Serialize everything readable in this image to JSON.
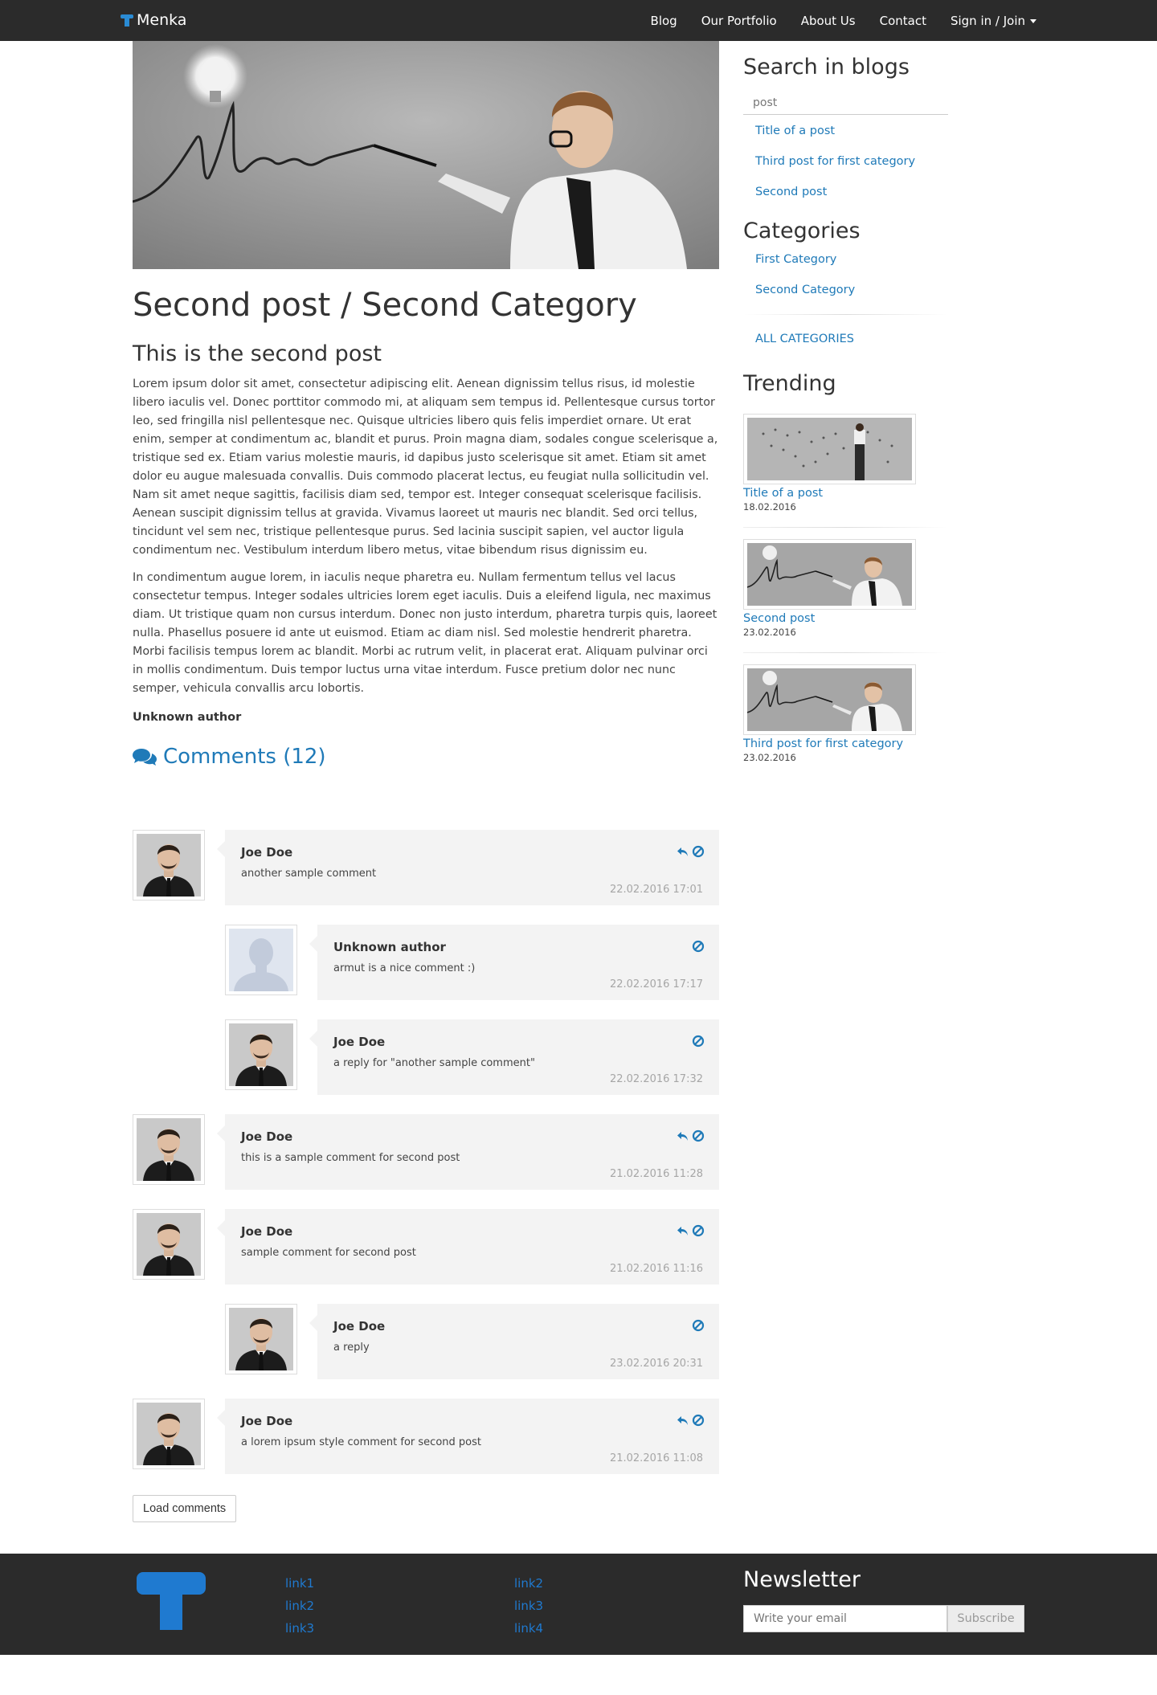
{
  "navbar": {
    "brand": "Menka",
    "items": [
      {
        "label": "Blog"
      },
      {
        "label": "Our Portfolio"
      },
      {
        "label": "About Us"
      },
      {
        "label": "Contact"
      },
      {
        "label": "Sign in / Join"
      }
    ]
  },
  "post": {
    "title": "Second post / Second Category",
    "subtitle": "This is the second post",
    "paragraphs": [
      "Lorem ipsum dolor sit amet, consectetur adipiscing elit. Aenean dignissim tellus risus, id molestie libero iaculis vel. Donec porttitor commodo mi, at aliquam sem tempus id. Pellentesque cursus tortor leo, sed fringilla nisl pellentesque nec. Quisque ultricies libero quis felis imperdiet ornare. Ut erat enim, semper at condimentum ac, blandit et purus. Proin magna diam, sodales congue scelerisque a, tristique sed ex. Etiam varius molestie mauris, id dapibus justo scelerisque sit amet. Etiam sit amet dolor eu augue malesuada convallis. Duis commodo placerat lectus, eu feugiat nulla sollicitudin vel. Nam sit amet neque sagittis, facilisis diam sed, tempor est. Integer consequat scelerisque facilisis. Aenean suscipit dignissim tellus at gravida. Vivamus laoreet ut mauris nec blandit. Sed orci tellus, tincidunt vel sem nec, tristique pellentesque purus. Sed lacinia suscipit sapien, vel auctor ligula condimentum nec. Vestibulum interdum libero metus, vitae bibendum risus dignissim eu.",
      "In condimentum augue lorem, in iaculis neque pharetra eu. Nullam fermentum tellus vel lacus consectetur tempus. Integer sodales ultricies lorem eget iaculis. Duis a eleifend ligula, nec maximus diam. Ut tristique quam non cursus interdum. Donec non justo interdum, pharetra turpis quis, laoreet nulla. Phasellus posuere id ante ut euismod. Etiam ac diam nisl. Sed molestie hendrerit pharetra. Morbi facilisis tempus lorem ac blandit. Morbi ac rutrum velit, in placerat erat. Aliquam pulvinar orci in mollis condimentum. Duis tempor luctus urna vitae interdum. Fusce pretium dolor nec nunc semper, vehicula convallis arcu lobortis."
    ],
    "author": "Unknown author"
  },
  "comments": {
    "heading": "Comments (12)",
    "items": [
      {
        "author": "Joe Doe",
        "text": "another sample comment",
        "date": "22.02.2016 17:01",
        "child": false,
        "avatar": "man",
        "reply": true
      },
      {
        "author": "Unknown author",
        "text": "armut is a nice comment :)",
        "date": "22.02.2016 17:17",
        "child": true,
        "avatar": "silhouette",
        "reply": false
      },
      {
        "author": "Joe Doe",
        "text": "a reply for \"another sample comment\"",
        "date": "22.02.2016 17:32",
        "child": true,
        "avatar": "man",
        "reply": false
      },
      {
        "author": "Joe Doe",
        "text": "this is a sample comment for second post",
        "date": "21.02.2016 11:28",
        "child": false,
        "avatar": "man",
        "reply": true
      },
      {
        "author": "Joe Doe",
        "text": "sample comment for second post",
        "date": "21.02.2016 11:16",
        "child": false,
        "avatar": "man",
        "reply": true
      },
      {
        "author": "Joe Doe",
        "text": "a reply",
        "date": "23.02.2016 20:31",
        "child": true,
        "avatar": "man",
        "reply": false
      },
      {
        "author": "Joe Doe",
        "text": "a lorem ipsum style comment for second post",
        "date": "21.02.2016 11:08",
        "child": false,
        "avatar": "man",
        "reply": true
      }
    ],
    "load_label": "Load comments"
  },
  "sidebar": {
    "search_title": "Search in blogs",
    "search_value": "post",
    "search_results": [
      "Title of a post",
      "Third post for first category",
      "Second post"
    ],
    "categories_title": "Categories",
    "categories": [
      "First Category",
      "Second Category"
    ],
    "all_categories": "ALL CATEGORIES",
    "trending_title": "Trending",
    "trending": [
      {
        "title": "Title of a post",
        "date": "18.02.2016",
        "image": "map"
      },
      {
        "title": "Second post",
        "date": "23.02.2016",
        "image": "idea"
      },
      {
        "title": "Third post for first category",
        "date": "23.02.2016",
        "image": "idea"
      }
    ]
  },
  "footer": {
    "col1": [
      "link1",
      "link2",
      "link3"
    ],
    "col2": [
      "link2",
      "link3",
      "link4"
    ],
    "newsletter_title": "Newsletter",
    "email_placeholder": "Write your email",
    "subscribe_label": "Subscribe"
  },
  "colors": {
    "accent": "#1f7ab8",
    "navbar": "#2b2b2b",
    "footer_accent": "#1f7ad0"
  }
}
